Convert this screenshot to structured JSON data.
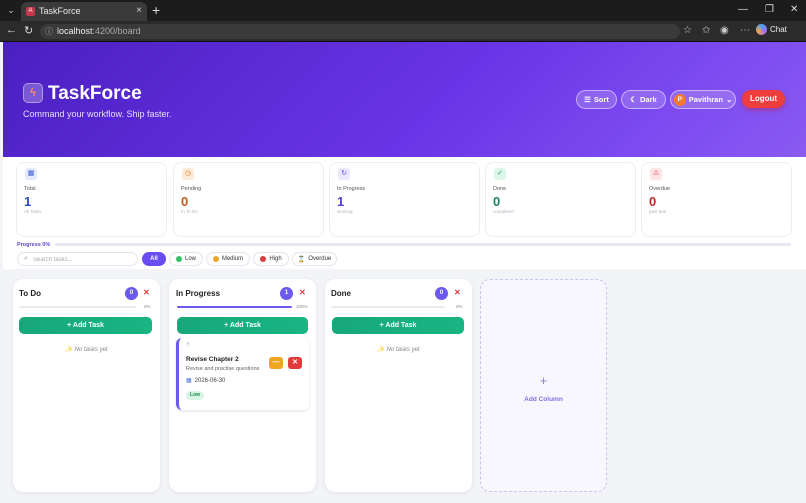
{
  "browser": {
    "tab_title": "TaskForce",
    "url_host": "localhost",
    "url_path": ":4200/board",
    "chat_label": "Chat"
  },
  "header": {
    "title": "TaskForce",
    "subtitle": "Command your workflow. Ship faster.",
    "sort_label": "Sort",
    "theme_label": "Dark",
    "user_initial": "P",
    "user_name": "Pavithran",
    "logout_label": "Logout"
  },
  "stats": [
    {
      "label": "Total",
      "value": "1",
      "sub": "All Tasks",
      "color": "#2a49c9",
      "icon_bg": "#e3e9ff",
      "icon_color": "#3a55d0"
    },
    {
      "label": "Pending",
      "value": "0",
      "sub": "In To Do",
      "color": "#c45a12",
      "icon_bg": "#fdebd9",
      "icon_color": "#e07820"
    },
    {
      "label": "In Progress",
      "value": "1",
      "sub": "working",
      "color": "#5a3ccf",
      "icon_bg": "#ece6ff",
      "icon_color": "#6a4df0"
    },
    {
      "label": "Done",
      "value": "0",
      "sub": "completed",
      "color": "#17875a",
      "icon_bg": "#dcf6ea",
      "icon_color": "#1fa06d"
    },
    {
      "label": "Overdue",
      "value": "0",
      "sub": "past due",
      "color": "#c02828",
      "icon_bg": "#fde3e3",
      "icon_color": "#e03b3b"
    }
  ],
  "progress": {
    "label": "Progress 0%",
    "fraction": 0
  },
  "search": {
    "placeholder": "Search tasks..."
  },
  "filters": {
    "all": "All",
    "low": "Low",
    "medium": "Medium",
    "high": "High",
    "overdue": "Overdue"
  },
  "columns": [
    {
      "title": "To Do",
      "count": "0",
      "percent": "0%",
      "fraction": 0,
      "add_label": "+ Add Task",
      "empty": "✨ No tasks yet"
    },
    {
      "title": "In Progress",
      "count": "1",
      "percent": "100%",
      "fraction": 1,
      "add_label": "+ Add Task",
      "task": {
        "title": "Revise Chapter 2",
        "description": "Revise and practise questions",
        "date": "2026-06-30",
        "priority": "Low"
      }
    },
    {
      "title": "Done",
      "count": "0",
      "percent": "0%",
      "fraction": 0,
      "add_label": "+ Add Task",
      "empty": "✨ No tasks yet"
    }
  ],
  "add_column": {
    "plus": "+",
    "label": "Add Column"
  }
}
